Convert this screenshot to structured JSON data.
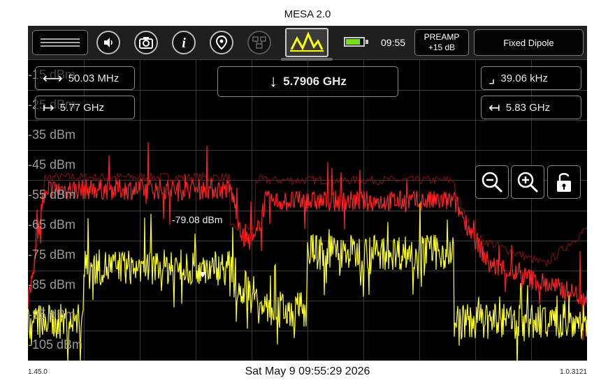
{
  "app": {
    "title": "MESA 2.0"
  },
  "toolbar": {
    "clock": "09:55",
    "preamp_label": "PREAMP",
    "preamp_value": "+15 dB",
    "antenna": "Fixed Dipole",
    "battery_color": "#7ddc1f"
  },
  "overlays": {
    "span": "50.03 MHz",
    "start": "5.77 GHz",
    "center": "5.7906 GHz",
    "rbw": "39.06 kHz",
    "stop": "5.83 GHz",
    "marker_level": "-79.08 dBm"
  },
  "chart_data": {
    "type": "line",
    "y_tick_labels": [
      "-15 dBm",
      "-25 dBm",
      "-35 dBm",
      "-45 dBm",
      "-55 dBm",
      "-65 dBm",
      "-75 dBm",
      "-85 dBm",
      "-95 dBm",
      "-105 dBm"
    ],
    "x_range_ghz": [
      5.77,
      5.83
    ],
    "y_range_dbm": [
      -110,
      -10
    ],
    "grid": true,
    "series": [
      {
        "color": "#ff2020",
        "role": "live-trace"
      },
      {
        "color": "#ffff22",
        "role": "live-trace"
      },
      {
        "color": "#8a1010",
        "role": "max-hold"
      }
    ]
  },
  "footer": {
    "left_version": "1.45.0",
    "datetime": "Sat May 9 09:55:29 2026",
    "right_version": "1.0.3121"
  }
}
